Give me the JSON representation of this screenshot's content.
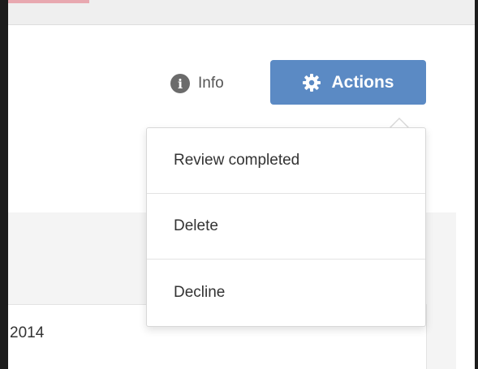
{
  "toolbar": {
    "info_label": "Info",
    "actions_label": "Actions",
    "info_icon": "info-icon",
    "actions_icon": "gear-icon"
  },
  "dropdown": {
    "items": [
      {
        "label": "Review completed"
      },
      {
        "label": "Delete"
      },
      {
        "label": "Decline"
      }
    ]
  },
  "content": {
    "date_fragment": "2014"
  },
  "colors": {
    "accent": "#5b8ac4",
    "info_icon": "#6b6b6b"
  }
}
